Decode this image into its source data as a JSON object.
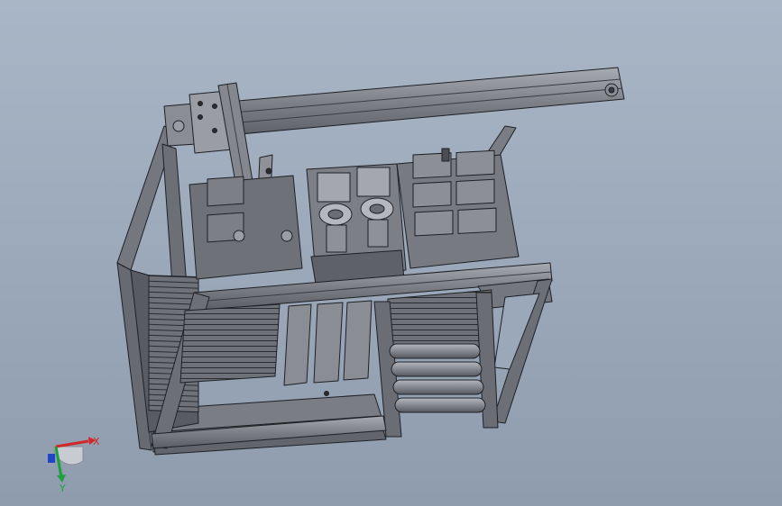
{
  "viewport": {
    "background_top": "#a9b6c6",
    "background_bottom": "#8e9cae"
  },
  "model": {
    "frame_color": "#6a6e74",
    "edge_color": "#1e2024",
    "roller_color": "#8a8e94",
    "face_light": "#9a9ea4"
  },
  "triad": {
    "x_label": "X",
    "y_label": "Y",
    "x_color": "#d0282a",
    "y_color": "#1ea03c",
    "z_color": "#2046c8"
  }
}
